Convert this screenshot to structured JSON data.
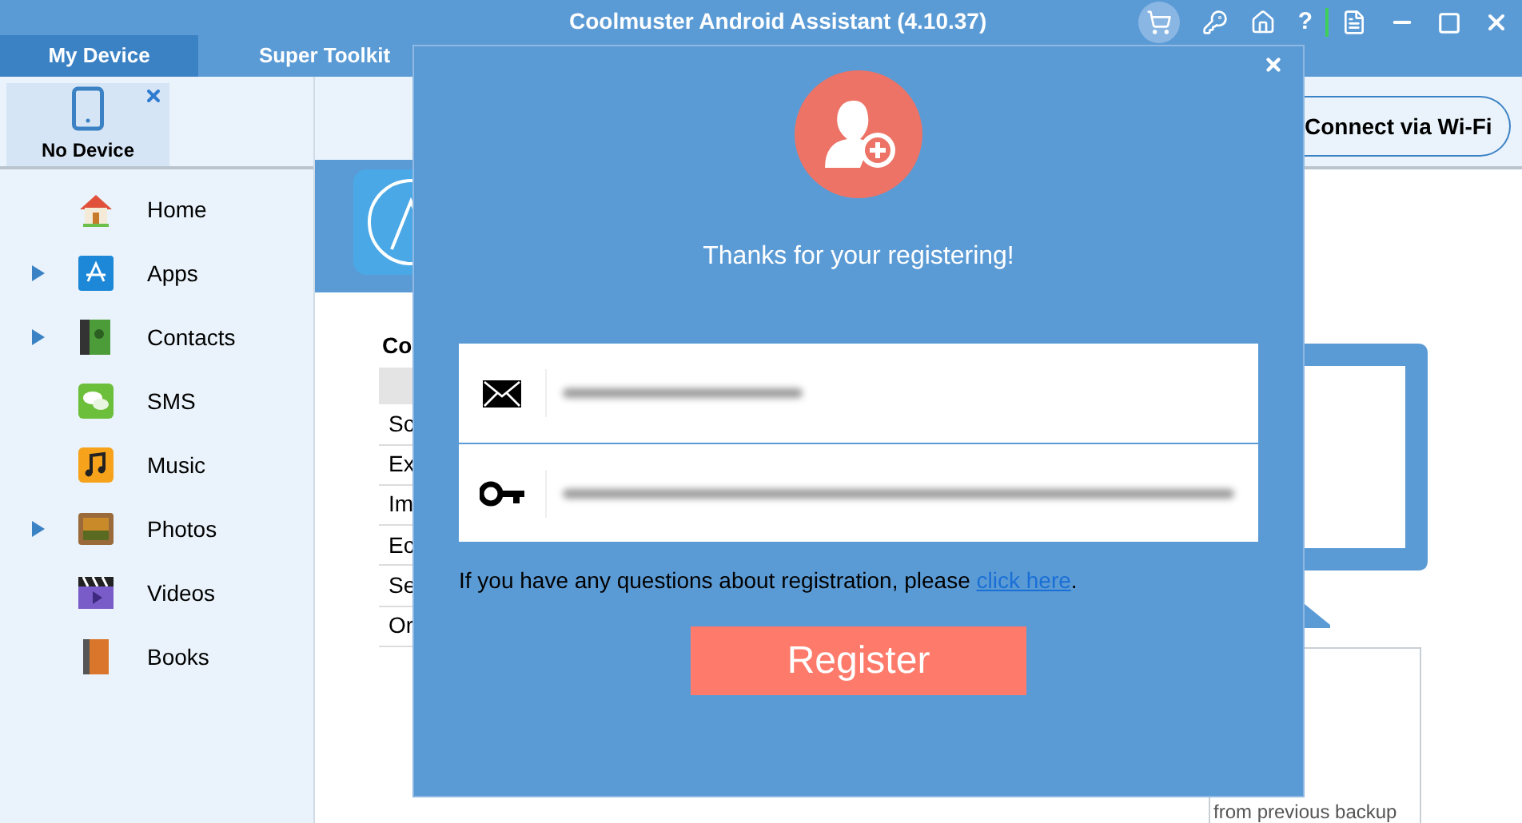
{
  "window": {
    "title": "Coolmuster Android Assistant (4.10.37)",
    "help_glyph": "?"
  },
  "tabs": [
    {
      "label": "My Device",
      "selected": true
    },
    {
      "label": "Super Toolkit",
      "selected": false
    }
  ],
  "device": {
    "label": "No Device"
  },
  "connect_button": "Connect via Wi-Fi",
  "sidebar": {
    "items": [
      {
        "label": "Home",
        "expandable": false
      },
      {
        "label": "Apps",
        "expandable": true
      },
      {
        "label": "Contacts",
        "expandable": true
      },
      {
        "label": "SMS",
        "expandable": false
      },
      {
        "label": "Music",
        "expandable": false
      },
      {
        "label": "Photos",
        "expandable": true
      },
      {
        "label": "Videos",
        "expandable": false
      },
      {
        "label": "Books",
        "expandable": false
      }
    ]
  },
  "content": {
    "heading": "Co",
    "rows": [
      "Sc",
      "Ex",
      "Im",
      "Ec",
      "Se",
      "Or"
    ],
    "card_text": "from previous backup"
  },
  "dialog": {
    "message": "Thanks for your registering!",
    "fields": [
      {
        "kind": "email"
      },
      {
        "kind": "key"
      }
    ],
    "hint": "If you have any questions about registration, please ",
    "hint_link": "click here",
    "hint_end": ".",
    "button": "Register"
  }
}
